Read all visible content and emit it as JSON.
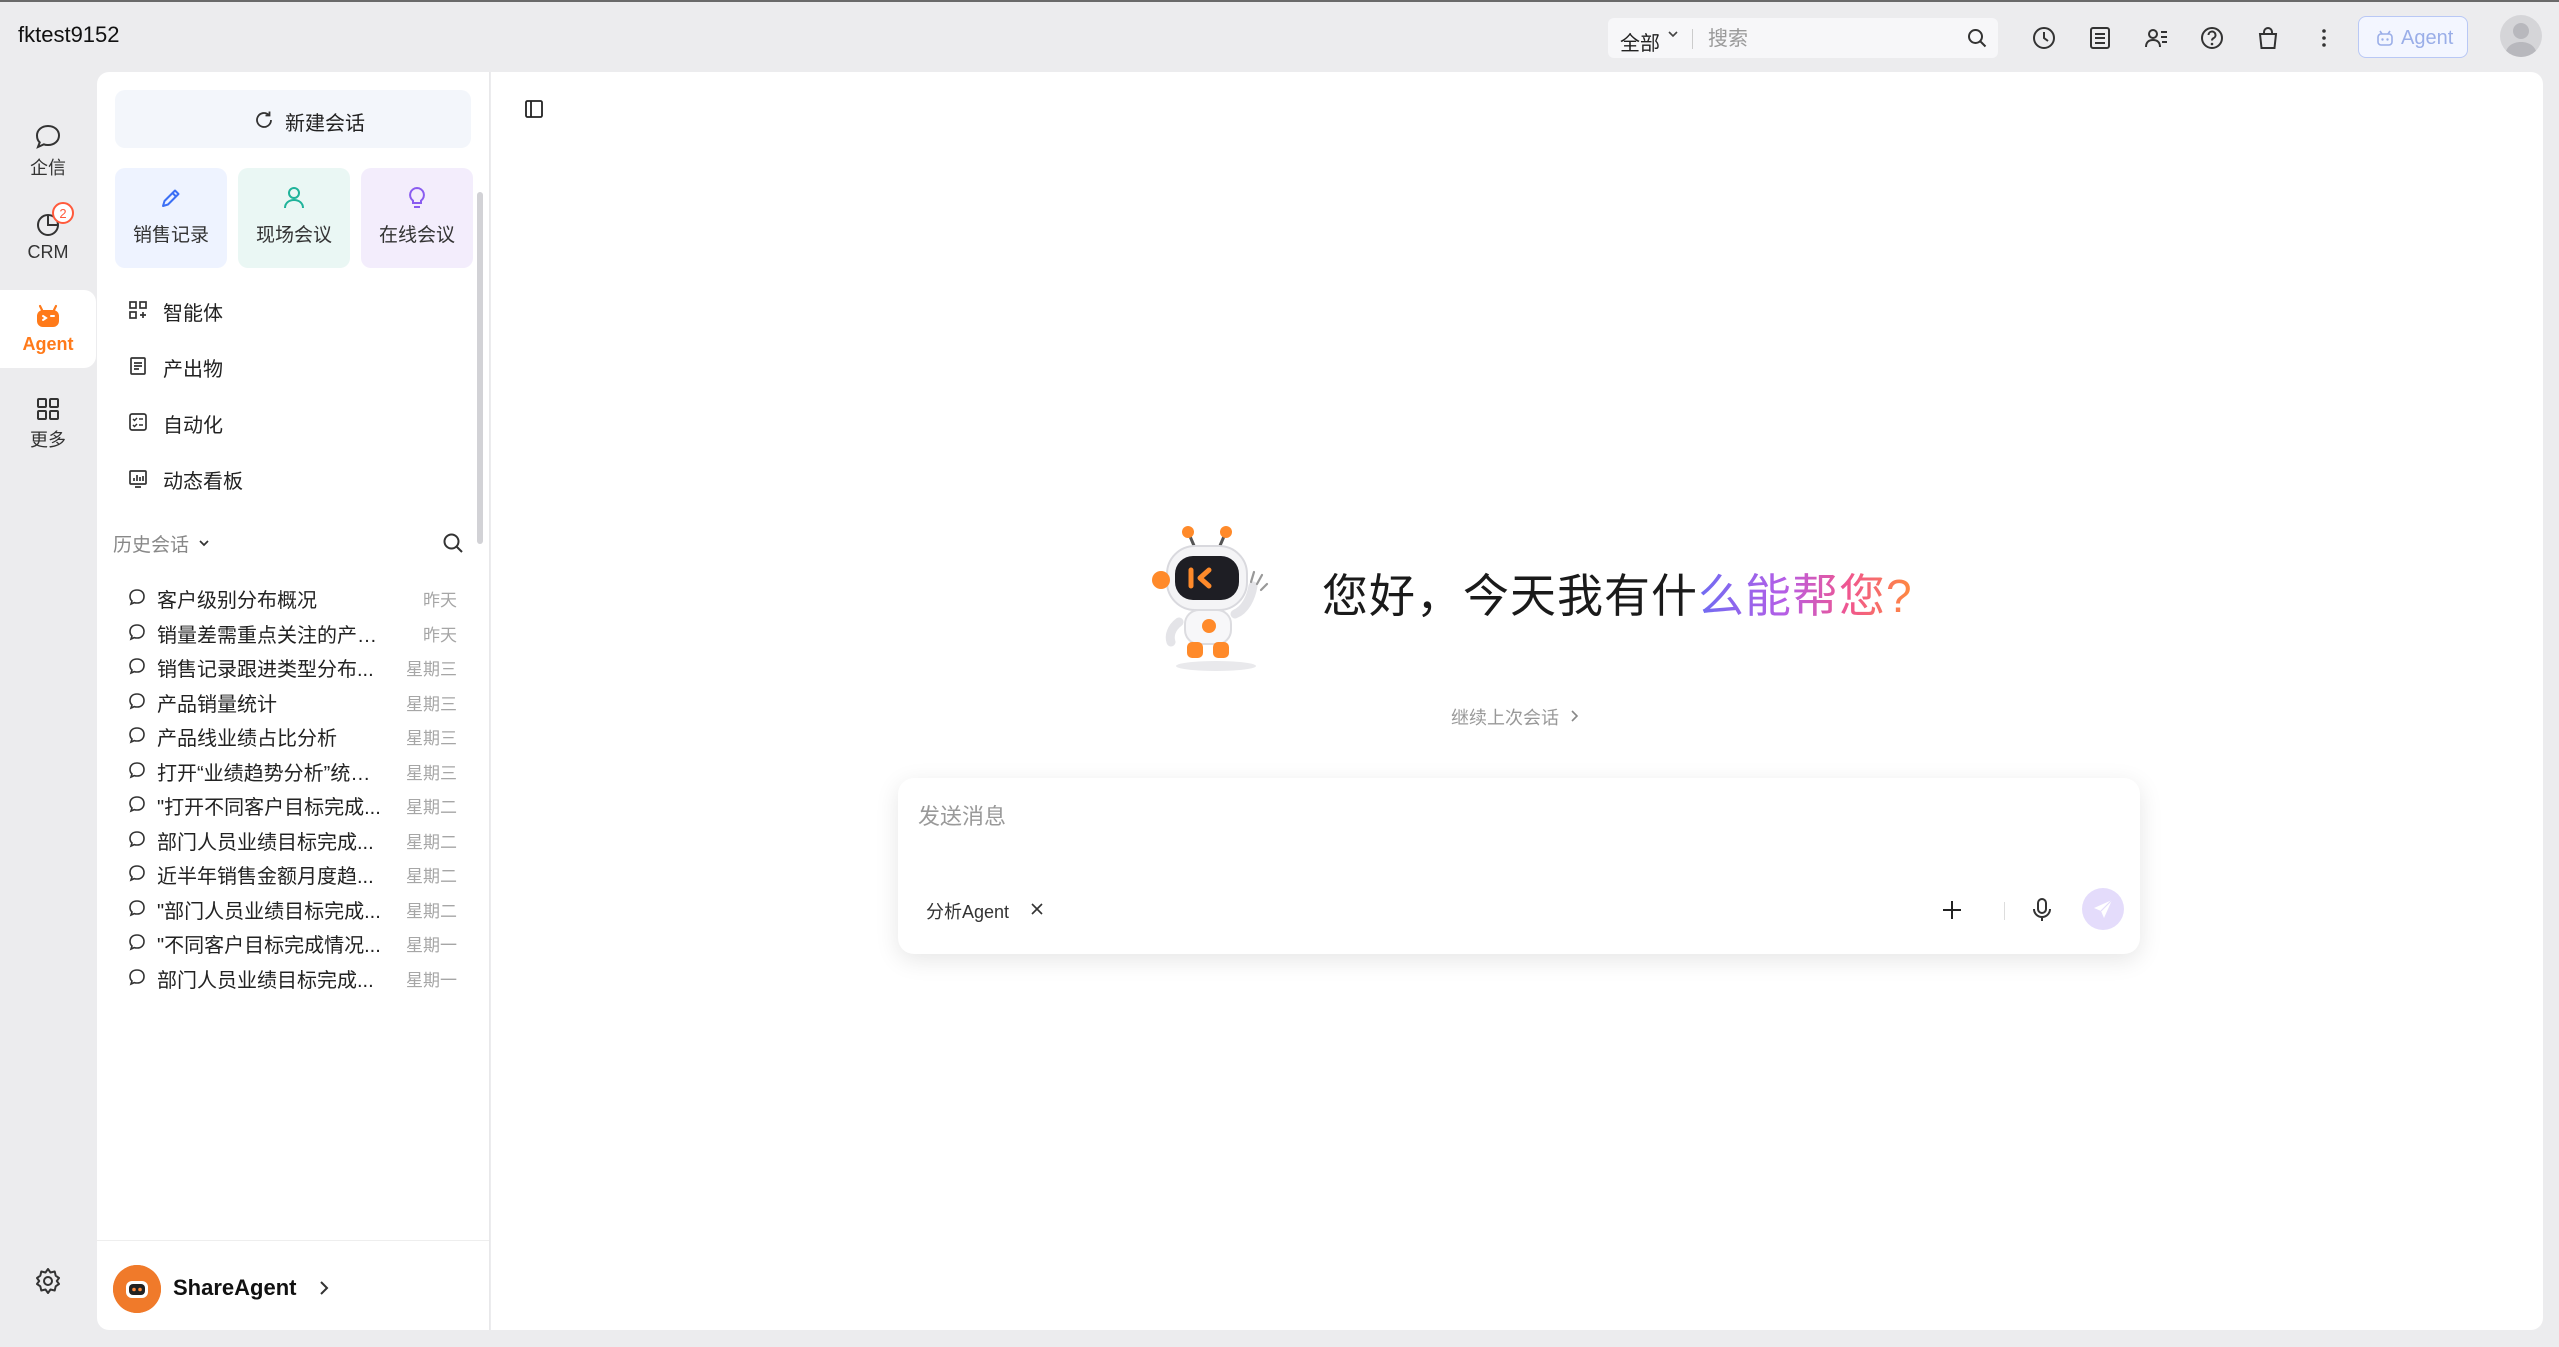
{
  "topbar": {
    "tenant": "fktest9152",
    "search_scope": "全部",
    "search_placeholder": "搜索",
    "agent_button": "Agent",
    "icons": [
      "clock-icon",
      "report-icon",
      "contacts-icon",
      "help-icon",
      "shopping-bag-icon",
      "more-vertical-icon"
    ]
  },
  "rail": {
    "items": [
      {
        "label": "企信",
        "icon": "chat-icon"
      },
      {
        "label": "CRM",
        "icon": "crm-pie-icon",
        "badge": "2"
      },
      {
        "label": "Agent",
        "icon": "robot-icon",
        "active": true
      },
      {
        "label": "更多",
        "icon": "grid-icon"
      }
    ],
    "settings_icon": "settings-icon"
  },
  "sidebar": {
    "new_chat": "新建会话",
    "quick_actions": [
      {
        "label": "销售记录",
        "icon": "pencil-icon",
        "color": "#3b6ff5"
      },
      {
        "label": "现场会议",
        "icon": "person-icon",
        "color": "#1fb39a"
      },
      {
        "label": "在线会议",
        "icon": "lightbulb-icon",
        "color": "#8a5cf0"
      }
    ],
    "nav": [
      {
        "label": "智能体",
        "icon": "apps-icon"
      },
      {
        "label": "产出物",
        "icon": "document-icon"
      },
      {
        "label": "自动化",
        "icon": "checklist-icon"
      },
      {
        "label": "动态看板",
        "icon": "dashboard-icon"
      }
    ],
    "history_title": "历史会话",
    "history": [
      {
        "title": "客户级别分布概况",
        "date": "昨天"
      },
      {
        "title": "销量差需重点关注的产品...",
        "date": "昨天"
      },
      {
        "title": "销售记录跟进类型分布...",
        "date": "星期三"
      },
      {
        "title": "产品销量统计",
        "date": "星期三"
      },
      {
        "title": "产品线业绩占比分析",
        "date": "星期三"
      },
      {
        "title": "打开“业绩趋势分析”统计图",
        "date": "星期三"
      },
      {
        "title": "\"打开不同客户目标完成...",
        "date": "星期二"
      },
      {
        "title": "部门人员业绩目标完成...",
        "date": "星期二"
      },
      {
        "title": "近半年销售金额月度趋...",
        "date": "星期二"
      },
      {
        "title": "\"部门人员业绩目标完成...",
        "date": "星期二"
      },
      {
        "title": "\"不同客户目标完成情况...",
        "date": "星期一"
      },
      {
        "title": "部门人员业绩目标完成...",
        "date": "星期一"
      }
    ],
    "footer_name": "ShareAgent"
  },
  "main": {
    "greeting_plain": "您好，今天我有什",
    "greeting_gradient": "么能帮您?",
    "continue_label": "继续上次会话",
    "composer_placeholder": "发送消息",
    "agent_chip": "分析Agent"
  },
  "colors": {
    "accent_orange": "#ff7a1a",
    "badge_red": "#ff5a3c",
    "send_bg": "#e4dcfb"
  }
}
